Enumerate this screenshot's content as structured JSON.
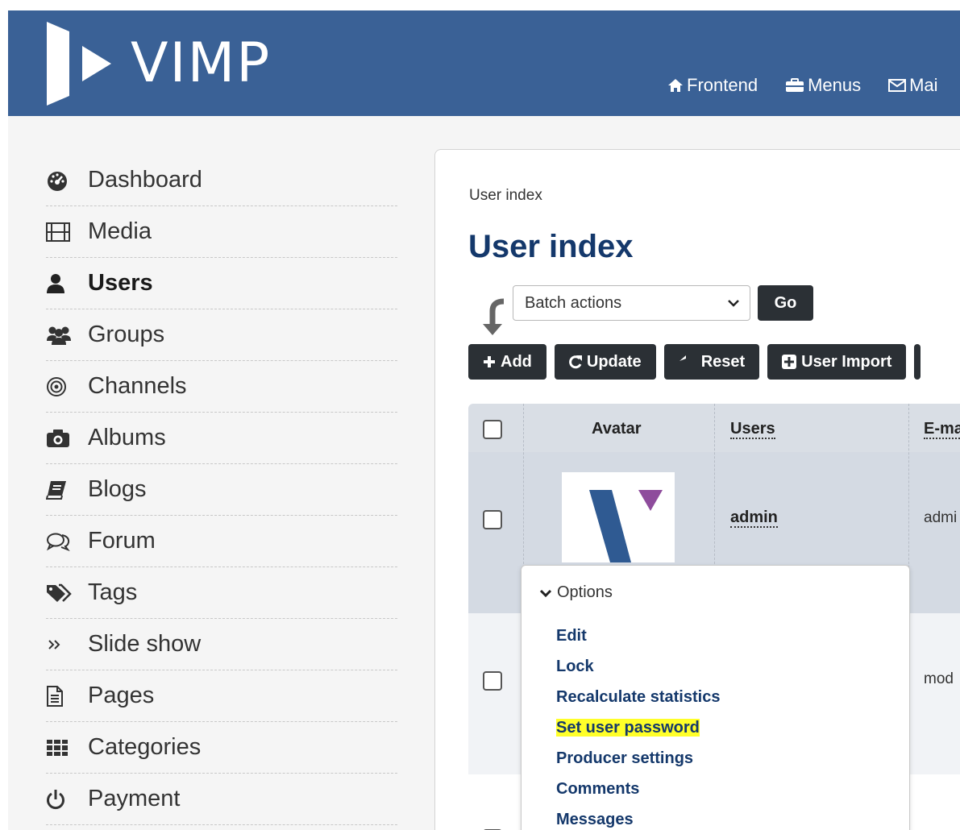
{
  "header": {
    "logo_text": "VIMP",
    "nav": [
      {
        "label": "Frontend",
        "icon": "home-icon"
      },
      {
        "label": "Menus",
        "icon": "briefcase-icon"
      },
      {
        "label": "Mai",
        "icon": "envelope-icon"
      }
    ],
    "background": "#3a6196"
  },
  "sidebar": {
    "items": [
      {
        "label": "Dashboard",
        "icon": "dashboard-icon"
      },
      {
        "label": "Media",
        "icon": "film-icon"
      },
      {
        "label": "Users",
        "icon": "user-icon",
        "active": true
      },
      {
        "label": "Groups",
        "icon": "group-icon"
      },
      {
        "label": "Channels",
        "icon": "channel-icon"
      },
      {
        "label": "Albums",
        "icon": "camera-icon"
      },
      {
        "label": "Blogs",
        "icon": "book-icon"
      },
      {
        "label": "Forum",
        "icon": "comments-icon"
      },
      {
        "label": "Tags",
        "icon": "tags-icon"
      },
      {
        "label": "Slide show",
        "icon": "double-chevron-icon"
      },
      {
        "label": "Pages",
        "icon": "file-icon"
      },
      {
        "label": "Categories",
        "icon": "grid-icon"
      },
      {
        "label": "Payment",
        "icon": "power-icon"
      }
    ]
  },
  "main": {
    "breadcrumb": "User index",
    "title": "User index",
    "batch": {
      "selected": "Batch actions",
      "go_label": "Go"
    },
    "toolbar": {
      "add": "Add",
      "update": "Update",
      "reset": "Reset",
      "import": "User Import"
    },
    "table": {
      "columns": [
        "Avatar",
        "Users",
        "E-ma"
      ],
      "rows": [
        {
          "user": "admin",
          "email": "admi"
        },
        {
          "user": "",
          "email": "mod"
        }
      ]
    },
    "options_menu": {
      "header": "Options",
      "items": [
        "Edit",
        "Lock",
        "Recalculate statistics",
        "Set user password",
        "Producer settings",
        "Comments",
        "Messages"
      ],
      "highlighted": "Set user password",
      "highlight_color": "#ffff29"
    }
  }
}
